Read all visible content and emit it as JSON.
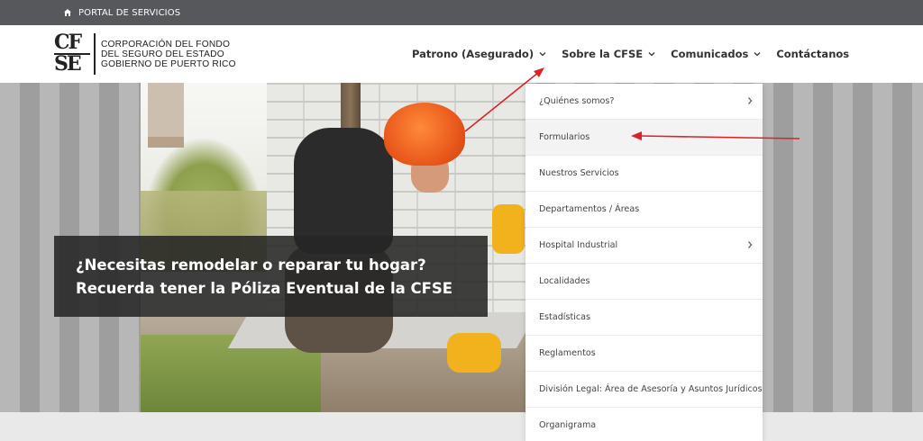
{
  "topbar": {
    "portal_label": "PORTAL DE SERVICIOS"
  },
  "logo": {
    "mark_line1": "CF",
    "mark_line2": "SE",
    "line1": "CORPORACIÓN DEL FONDO",
    "line2": "DEL SEGURO DEL ESTADO",
    "line3": "GOBIERNO DE PUERTO RICO"
  },
  "nav": {
    "items": [
      {
        "label": "Patrono (Asegurado)"
      },
      {
        "label": "Sobre la CFSE"
      },
      {
        "label": "Comunicados"
      },
      {
        "label": "Contáctanos"
      }
    ]
  },
  "hero": {
    "caption_line1": "¿Necesitas remodelar o reparar tu hogar?",
    "caption_line2": "Recuerda tener la Póliza Eventual de la CFSE"
  },
  "dropdown": {
    "items": [
      {
        "label": "¿Quiénes somos?"
      },
      {
        "label": "Formularios"
      },
      {
        "label": "Nuestros Servicios"
      },
      {
        "label": "Departamentos / Áreas"
      },
      {
        "label": "Hospital Industrial"
      },
      {
        "label": "Localidades"
      },
      {
        "label": "Estadísticas"
      },
      {
        "label": "Reglamentos"
      },
      {
        "label": "División Legal: Área de Asesoría y Asuntos Jurídicos"
      },
      {
        "label": "Organigrama"
      }
    ]
  },
  "colors": {
    "topbar": "#56585b",
    "annotation_arrow": "#d8232a",
    "caption_bg": "#262626"
  }
}
